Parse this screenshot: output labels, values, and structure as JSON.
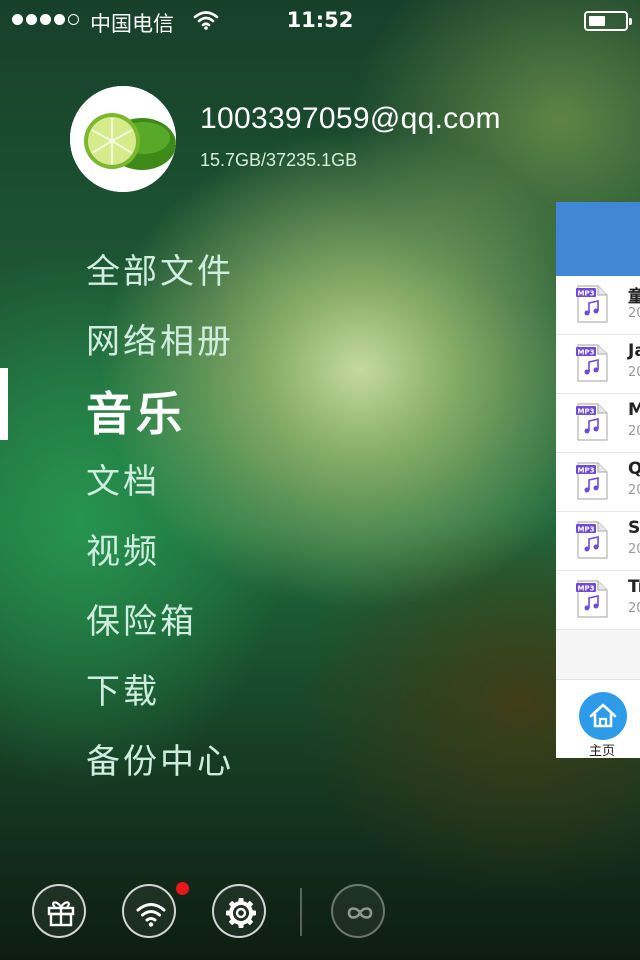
{
  "status_bar": {
    "carrier": "中国电信",
    "time": "11:52",
    "signal_bars": 4,
    "signal_total": 5,
    "battery_level": 0.45
  },
  "profile": {
    "email": "1003397059@qq.com",
    "storage": "15.7GB/37235.1GB"
  },
  "menu": {
    "items": [
      {
        "label": "全部文件"
      },
      {
        "label": "网络相册"
      },
      {
        "label": "音乐",
        "active": true
      },
      {
        "label": "文档"
      },
      {
        "label": "视频"
      },
      {
        "label": "保险箱"
      },
      {
        "label": "下载"
      },
      {
        "label": "备份中心"
      }
    ]
  },
  "content_panel": {
    "header_color": "#4287d6",
    "rows": [
      {
        "title": "童",
        "sub": "20",
        "icon_label": "MP3"
      },
      {
        "title": "Ja",
        "sub": "20",
        "icon_label": "MP3"
      },
      {
        "title": "M",
        "sub": "20",
        "icon_label": "MP3"
      },
      {
        "title": "Q",
        "sub": "20",
        "icon_label": "MP3"
      },
      {
        "title": "S",
        "sub": "20",
        "icon_label": "MP3"
      },
      {
        "title": "Tr",
        "sub": "20",
        "icon_label": "MP3"
      }
    ],
    "home_label": "主页"
  },
  "toolbar": {
    "icons": [
      "gift-icon",
      "wifi-icon",
      "settings-icon",
      "cloud-link-icon"
    ],
    "notification_color": "#e8171b"
  }
}
